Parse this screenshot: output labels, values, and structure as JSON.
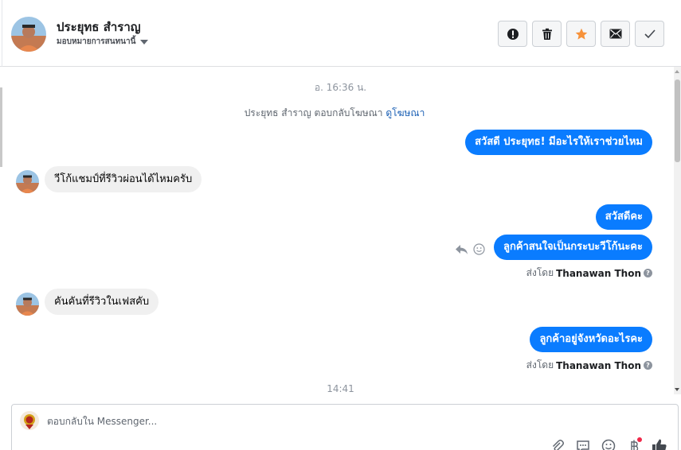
{
  "header": {
    "contact_name": "ประยุทธ สำราญ",
    "assign_label": "มอบหมายการสนทนานี้",
    "actions": [
      {
        "icon": "alert-icon",
        "name": "mark-spam-button"
      },
      {
        "icon": "trash-icon",
        "name": "delete-button"
      },
      {
        "icon": "star-icon",
        "name": "star-button",
        "color": "#f7923a"
      },
      {
        "icon": "envelope-icon",
        "name": "mark-unread-button"
      },
      {
        "icon": "check-icon",
        "name": "mark-done-button"
      }
    ]
  },
  "thread": {
    "timestamp_top": "อ. 16:36 น.",
    "system_text": "ประยุทธ สำราญ ตอบกลับโฆษณา",
    "system_link": "ดูโฆษณา",
    "messages": [
      {
        "dir": "out",
        "text": "สวัสดี ประยุทธ! มีอะไรให้เราช่วยไหม"
      },
      {
        "dir": "in",
        "text": "วีโก้แชมป์ที่รีวิวผ่อนได้ไหมครับ"
      },
      {
        "dir": "out",
        "text": "สวัสดีคะ"
      },
      {
        "dir": "out",
        "text": "ลูกค้าสนใจเป็นกระบะวีโก้นะคะ"
      },
      {
        "dir": "in",
        "text": "คันคันที่รีวิวในเฟสคับ"
      },
      {
        "dir": "out",
        "text": "ลูกค้าอยู่จังหวัดอะไรคะ"
      }
    ],
    "sent_by_label": "ส่งโดย",
    "sent_by_name": "Thanawan Thon",
    "timestamp_bottom": "14:41"
  },
  "composer": {
    "placeholder": "ตอบกลับใน Messenger...",
    "value": "",
    "tools": [
      "paperclip-icon",
      "saved-reply-icon",
      "emoji-icon",
      "baht-icon",
      "thumbs-up-icon"
    ]
  },
  "colors": {
    "outgoing_bubble": "#0a7cff",
    "incoming_bubble": "#f0f0f0",
    "link": "#1a5fb4",
    "accent_star": "#f7923a"
  }
}
